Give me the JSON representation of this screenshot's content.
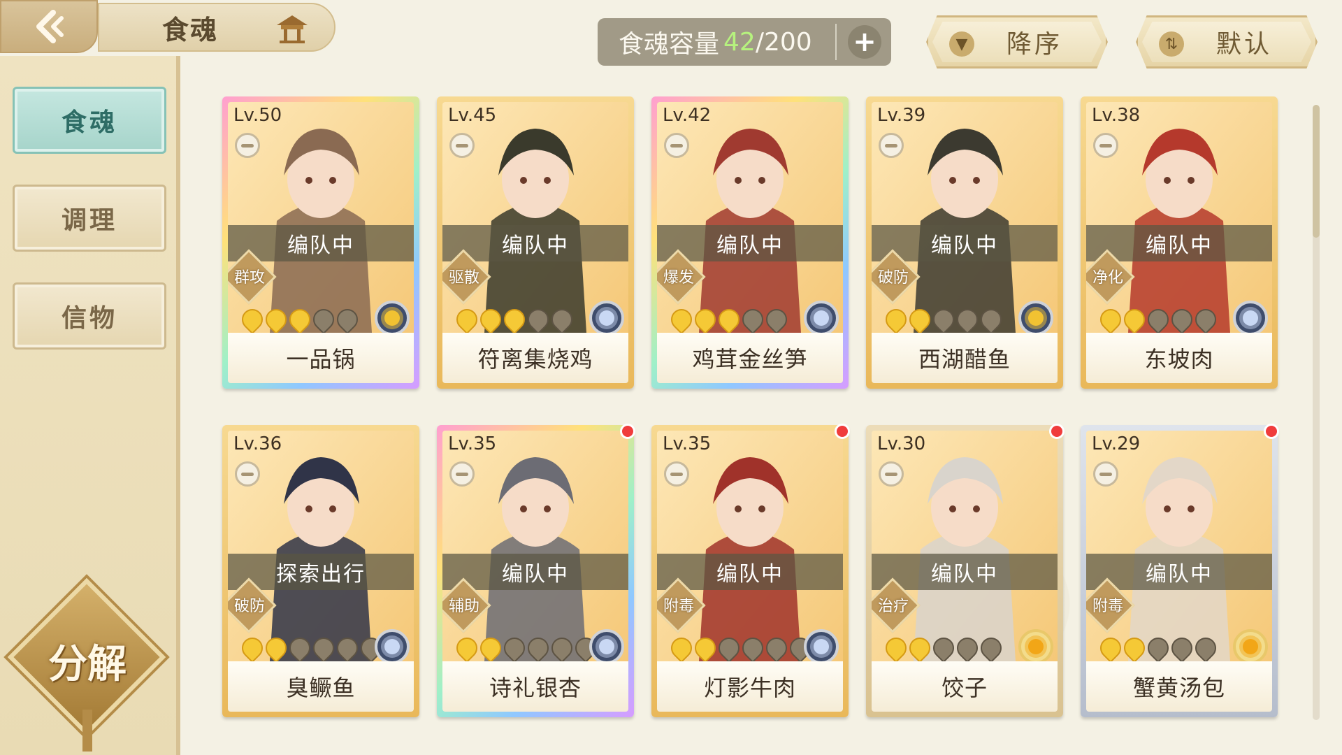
{
  "header": {
    "title": "食魂",
    "capacity_label": "食魂容量",
    "capacity_current": "42",
    "capacity_max": "/200",
    "plus_label": "+",
    "sort_desc_label": "降序",
    "sort_default_label": "默认"
  },
  "sidebar": {
    "items": [
      {
        "label": "食魂",
        "active": true
      },
      {
        "label": "调理",
        "active": false
      },
      {
        "label": "信物",
        "active": false
      }
    ],
    "decompose_label": "分解"
  },
  "cards": [
    {
      "level": "Lv.50",
      "status": "编队中",
      "role": "群攻",
      "stars_total": 5,
      "stars_on": 3,
      "name": "一品锅",
      "frame": "rainbow",
      "art_color": "#8a6a52",
      "element": "fire",
      "red_dot": false
    },
    {
      "level": "Lv.45",
      "status": "编队中",
      "role": "驱散",
      "stars_total": 5,
      "stars_on": 3,
      "name": "符离集烧鸡",
      "frame": "gold",
      "art_color": "#3a3a2c",
      "element": "blue",
      "red_dot": false
    },
    {
      "level": "Lv.42",
      "status": "编队中",
      "role": "爆发",
      "stars_total": 5,
      "stars_on": 3,
      "name": "鸡茸金丝笋",
      "frame": "rainbow",
      "art_color": "#a03a30",
      "element": "blue",
      "red_dot": false
    },
    {
      "level": "Lv.39",
      "status": "编队中",
      "role": "破防",
      "stars_total": 5,
      "stars_on": 2,
      "name": "西湖醋鱼",
      "frame": "gold",
      "art_color": "#3c3a30",
      "element": "fire",
      "red_dot": false
    },
    {
      "level": "Lv.38",
      "status": "编队中",
      "role": "净化",
      "stars_total": 5,
      "stars_on": 2,
      "name": "东坡肉",
      "frame": "gold",
      "art_color": "#b5392c",
      "element": "blue",
      "red_dot": false
    },
    {
      "level": "Lv.36",
      "status": "探索出行",
      "role": "破防",
      "stars_total": 6,
      "stars_on": 2,
      "name": "臭鳜鱼",
      "frame": "gold",
      "art_color": "#303448",
      "element": "blue",
      "red_dot": false
    },
    {
      "level": "Lv.35",
      "status": "编队中",
      "role": "辅助",
      "stars_total": 6,
      "stars_on": 2,
      "name": "诗礼银杏",
      "frame": "rainbow",
      "art_color": "#6c6c74",
      "element": "blue",
      "red_dot": true
    },
    {
      "level": "Lv.35",
      "status": "编队中",
      "role": "附毒",
      "stars_total": 6,
      "stars_on": 2,
      "name": "灯影牛肉",
      "frame": "gold",
      "art_color": "#a0322a",
      "element": "blue",
      "red_dot": true
    },
    {
      "level": "Lv.30",
      "status": "编队中",
      "role": "治疗",
      "stars_total": 5,
      "stars_on": 2,
      "name": "饺子",
      "frame": "plain",
      "art_color": "#d9d4cc",
      "element": "gold",
      "red_dot": true
    },
    {
      "level": "Lv.29",
      "status": "编队中",
      "role": "附毒",
      "stars_total": 5,
      "stars_on": 2,
      "name": "蟹黄汤包",
      "frame": "silver",
      "art_color": "#e3d7c8",
      "element": "gold",
      "red_dot": true
    }
  ]
}
